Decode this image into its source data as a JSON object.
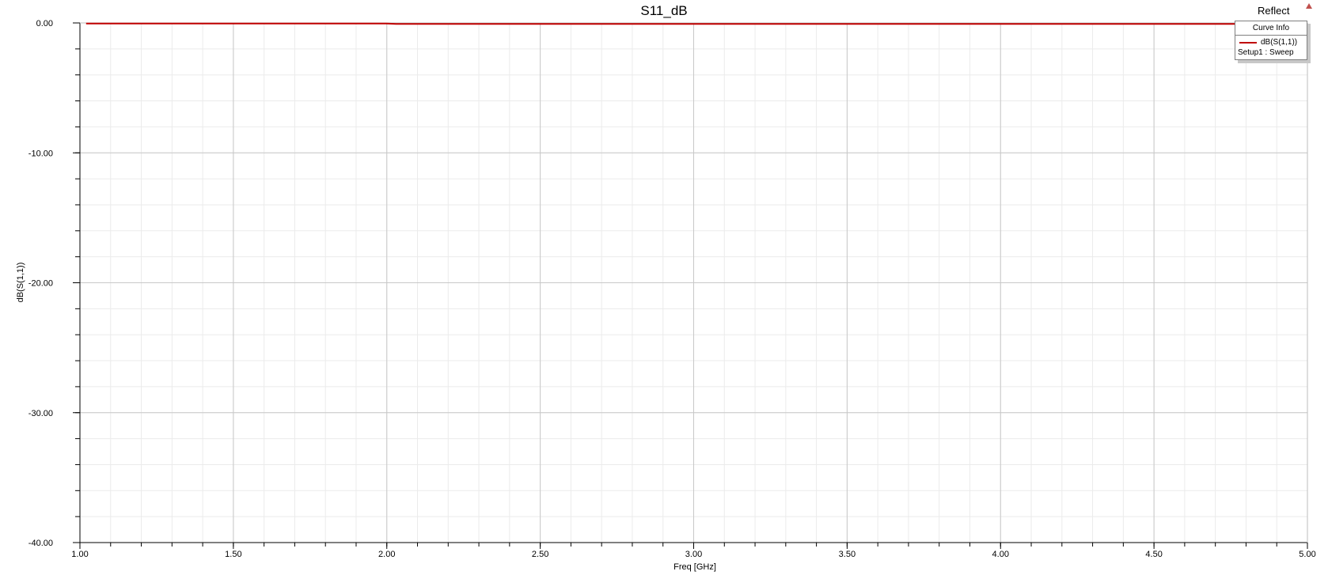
{
  "report": {
    "name": "Reflect"
  },
  "legend": {
    "header": "Curve Info",
    "items": [
      {
        "name": "dB(S(1,1))",
        "setup": "Setup1 : Sweep",
        "color": "#c00000"
      }
    ]
  },
  "chart_data": {
    "type": "line",
    "title": "S11_dB",
    "xlabel": "Freq [GHz]",
    "ylabel": "dB(S(1,1))",
    "xlim": [
      1.0,
      5.0
    ],
    "ylim": [
      -40.0,
      0.0
    ],
    "x_ticks": [
      "1.00",
      "1.50",
      "2.00",
      "2.50",
      "3.00",
      "3.50",
      "4.00",
      "4.50",
      "5.00"
    ],
    "y_ticks": [
      "0.00",
      "-10.00",
      "-20.00",
      "-30.00",
      "-40.00"
    ],
    "grid": true,
    "legend_position": "top-right",
    "series": [
      {
        "name": "dB(S(1,1))",
        "color": "#c00000",
        "x": [
          1.02,
          1.5,
          2.0,
          2.03,
          2.5,
          3.0,
          3.5,
          4.0,
          4.5,
          5.0
        ],
        "y": [
          -0.04,
          -0.04,
          -0.04,
          -0.08,
          -0.08,
          -0.08,
          -0.08,
          -0.08,
          -0.08,
          -0.08
        ]
      }
    ]
  }
}
